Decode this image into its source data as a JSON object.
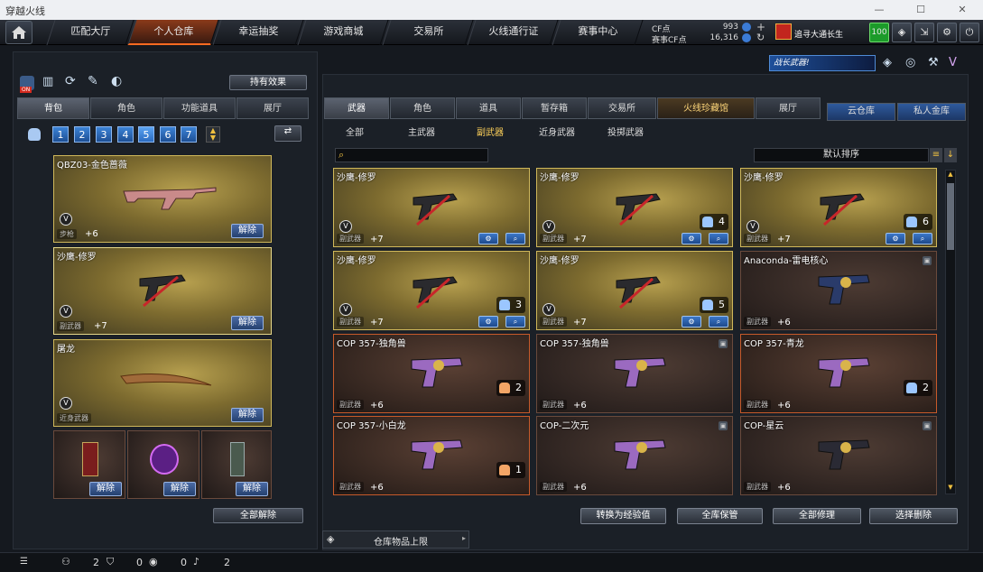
{
  "window": {
    "title": "穿越火线"
  },
  "nav": {
    "tabs": [
      "匹配大厅",
      "个人仓库",
      "幸运抽奖",
      "游戏商城",
      "交易所",
      "火线通行证",
      "赛事中心"
    ]
  },
  "currency": {
    "cf_label": "CF点",
    "cf_value": "993",
    "event_label": "赛事CF点",
    "event_value": "16,316"
  },
  "user": {
    "name": "追寻大通长生",
    "level": "100"
  },
  "left": {
    "effect_button": "持有效果",
    "tabs": [
      "背包",
      "角色",
      "功能道具",
      "展厅"
    ],
    "slots": [
      "1",
      "2",
      "3",
      "4",
      "5",
      "6",
      "7"
    ],
    "cards": [
      {
        "name": "QBZ03-金色蔷薇",
        "type": "步枪",
        "plus": "+6",
        "btn": "解除"
      },
      {
        "name": "沙鹰-修罗",
        "type": "副武器",
        "plus": "+7",
        "btn": "解除"
      },
      {
        "name": "屠龙",
        "type": "近身武器",
        "plus": "",
        "btn": "解除"
      }
    ],
    "items": [
      {
        "btn": "解除"
      },
      {
        "btn": "解除"
      },
      {
        "btn": "解除"
      }
    ],
    "release_all": "全部解除"
  },
  "right": {
    "badge_text": "战长武器!",
    "tabs": [
      "武器",
      "角色",
      "道具",
      "暂存箱",
      "交易所",
      "火线珍藏馆",
      "展厅"
    ],
    "cloud_tabs": [
      "云仓库",
      "私人金库"
    ],
    "subtabs": [
      "全部",
      "主武器",
      "副武器",
      "近身武器",
      "投掷武器"
    ],
    "sort_label": "默认排序",
    "search_placeholder": "",
    "grid": [
      {
        "name": "沙鹰-修罗",
        "type": "副武器",
        "plus": "+7",
        "count": ""
      },
      {
        "name": "沙鹰-修罗",
        "type": "副武器",
        "plus": "+7",
        "count": "4"
      },
      {
        "name": "沙鹰-修罗",
        "type": "副武器",
        "plus": "+7",
        "count": "6"
      },
      {
        "name": "沙鹰-修罗",
        "type": "副武器",
        "plus": "+7",
        "count": "3"
      },
      {
        "name": "沙鹰-修罗",
        "type": "副武器",
        "plus": "+7",
        "count": "5"
      },
      {
        "name": "Anaconda-雷电核心",
        "type": "副武器",
        "plus": "+6",
        "count": ""
      },
      {
        "name": "COP 357-独角兽",
        "type": "副武器",
        "plus": "+6",
        "count": "2"
      },
      {
        "name": "COP 357-独角兽",
        "type": "副武器",
        "plus": "+6",
        "count": ""
      },
      {
        "name": "COP 357-青龙",
        "type": "副武器",
        "plus": "+6",
        "count": "2"
      },
      {
        "name": "COP 357-小白龙",
        "type": "副武器",
        "plus": "+6",
        "count": "1"
      },
      {
        "name": "COP-二次元",
        "type": "副武器",
        "plus": "+6",
        "count": ""
      },
      {
        "name": "COP-星云",
        "type": "副武器",
        "plus": "+6",
        "count": ""
      }
    ],
    "actions": [
      "转换为经验值",
      "全库保管",
      "全部修理",
      "选择删除"
    ],
    "capacity_label": "仓库物品上限"
  },
  "status": {
    "a": "2",
    "b": "0",
    "c": "0",
    "d": "2"
  }
}
